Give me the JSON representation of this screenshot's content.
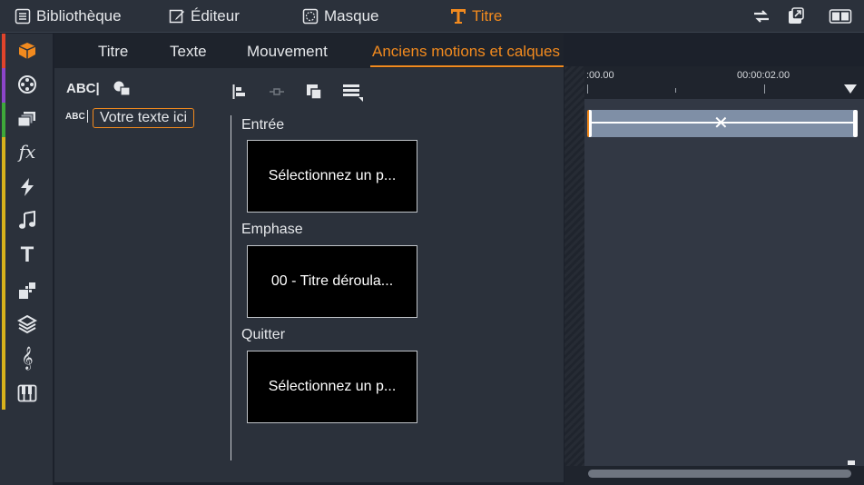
{
  "topbar": {
    "items": [
      {
        "label": "Bibliothèque",
        "icon": "list-icon"
      },
      {
        "label": "Éditeur",
        "icon": "edit-icon"
      },
      {
        "label": "Masque",
        "icon": "mask-icon"
      },
      {
        "label": "Titre",
        "icon": "title-t-icon"
      }
    ],
    "active_index": 3,
    "right_icons": [
      "swap-icon",
      "export-icon",
      "layout-icon"
    ]
  },
  "sidebar": {
    "icons": [
      "package-icon",
      "film-reel-icon",
      "stack-icon",
      "fx-icon",
      "lightning-icon",
      "music-note-icon",
      "title-t-icon",
      "transition-icon",
      "layers-icon",
      "treble-clef-icon",
      "piano-icon"
    ],
    "strip_colors": [
      "#e0442b",
      "#8c45c9",
      "#3ea83a",
      "#d8b21c"
    ]
  },
  "tabs": {
    "items": [
      "Titre",
      "Texte",
      "Mouvement",
      "Anciens motions et calques"
    ],
    "active_index": 3
  },
  "layers": {
    "add_text_icon_label": "ABC|",
    "layer_icon_label": "ABC",
    "layer_text": "Votre texte ici"
  },
  "motions": {
    "entree_label": "Entrée",
    "entree_value": "Sélectionnez un p...",
    "emphase_label": "Emphase",
    "emphase_value": "00 - Titre déroula...",
    "quitter_label": "Quitter",
    "quitter_value": "Sélectionnez un p..."
  },
  "timeline": {
    "ruler_start": ":00.00",
    "ruler_mark": "00:00:02.00"
  },
  "colors": {
    "accent": "#f28a1e",
    "background": "#2b313b",
    "clip": "#7f8fa6"
  }
}
